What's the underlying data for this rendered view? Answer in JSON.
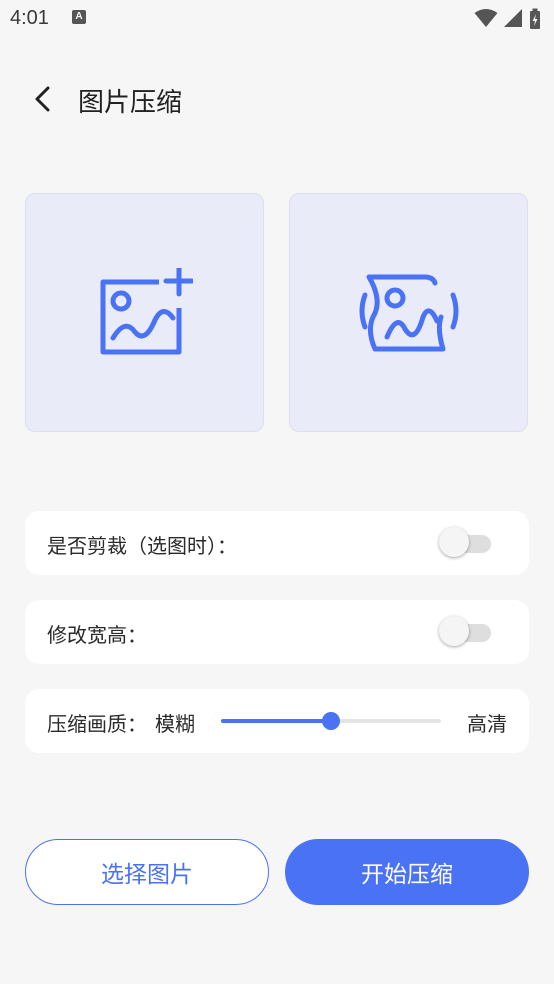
{
  "status_bar": {
    "time": "4:01",
    "icons": [
      "accessibility-a-icon",
      "wifi-icon",
      "signal-icon",
      "battery-charging-icon"
    ]
  },
  "header": {
    "back_icon": "chevron-left-icon",
    "title": "图片压缩"
  },
  "image_boxes": [
    {
      "icon": "add-image-icon"
    },
    {
      "icon": "compress-image-icon"
    }
  ],
  "options": {
    "crop": {
      "label": "是否剪裁（选图时）：",
      "enabled": false
    },
    "resize": {
      "label": "修改宽高：",
      "enabled": false
    },
    "quality": {
      "label": "压缩画质：",
      "min_label": "模糊",
      "max_label": "高清",
      "value": 0.5
    }
  },
  "buttons": {
    "select": "选择图片",
    "start": "开始压缩"
  },
  "colors": {
    "accent": "#4a72f5",
    "background": "#f6f6f6",
    "image_box_bg": "#e9ebf8",
    "card_bg": "#ffffff"
  }
}
